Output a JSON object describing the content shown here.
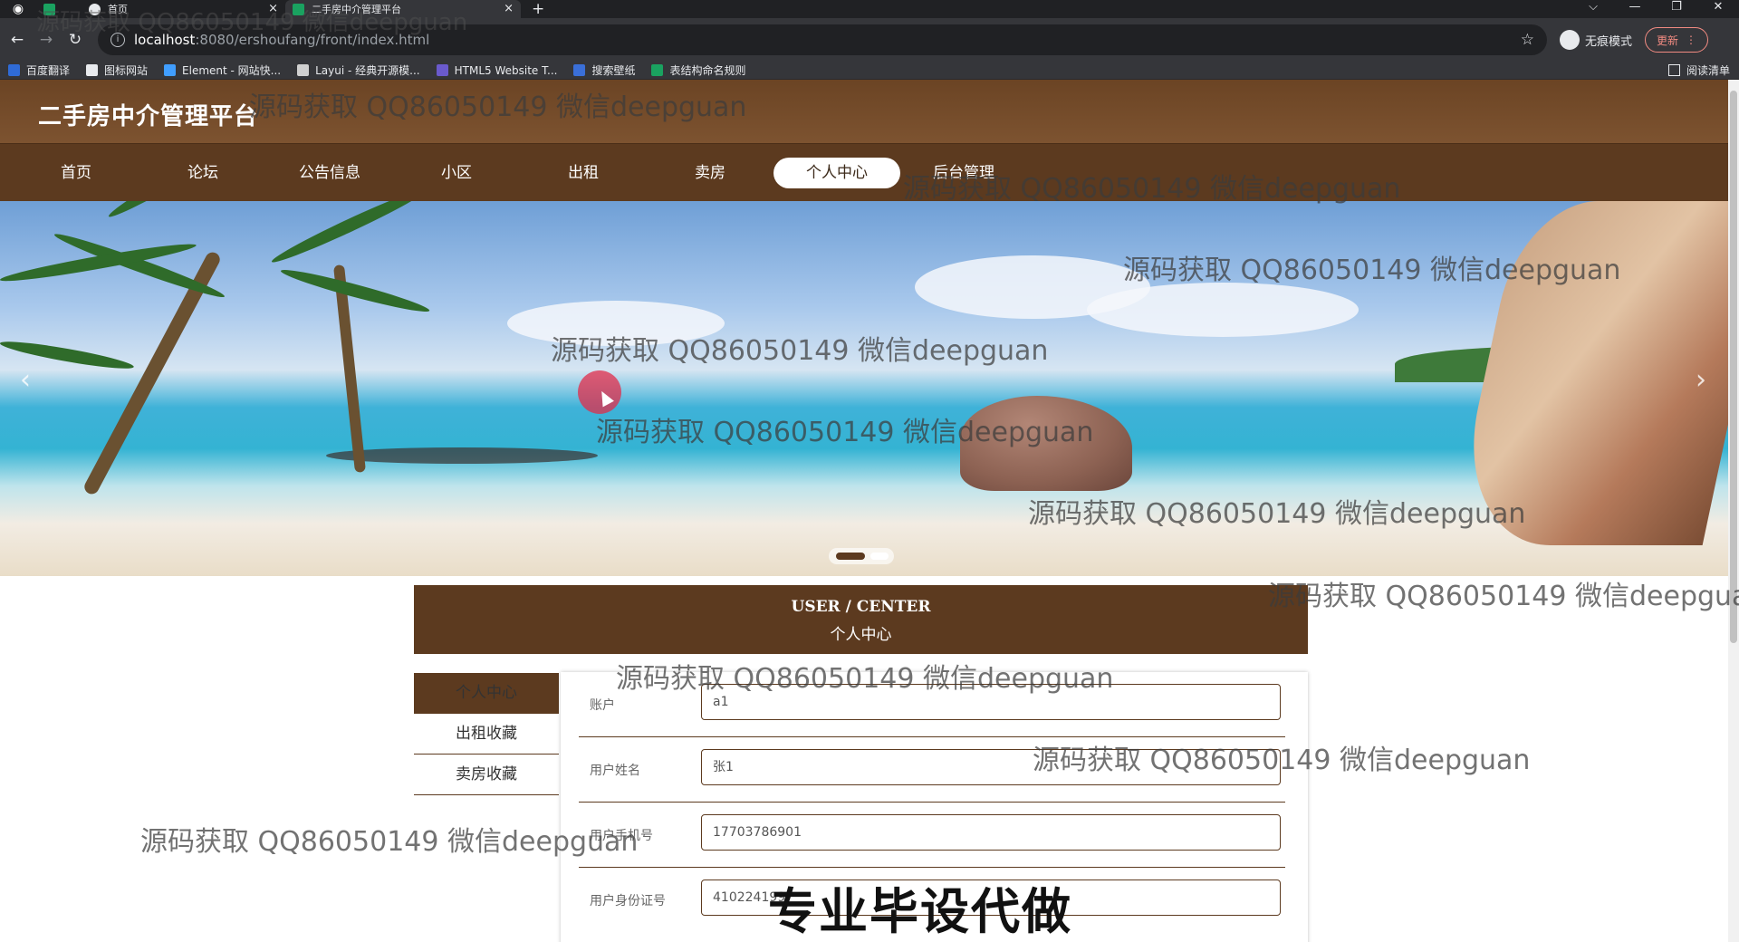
{
  "browser": {
    "tabs": [
      {
        "label": ""
      },
      {
        "label": "首页"
      },
      {
        "label": "二手房中介管理平台"
      }
    ],
    "new_tab": "+",
    "window_controls": [
      "⌵",
      "—",
      "❐",
      "✕"
    ],
    "url_host": "localhost",
    "url_path": ":8080/ershoufang/front/index.html",
    "profile_label": "无痕模式",
    "update_label": "更新",
    "bookmarks": [
      {
        "label": "百度翻译",
        "color": "#2f6bd6"
      },
      {
        "label": "图标网站",
        "color": "#e8eaed"
      },
      {
        "label": "Element - 网站快...",
        "color": "#409eff"
      },
      {
        "label": "Layui - 经典开源模...",
        "color": "#d0d0d0"
      },
      {
        "label": "HTML5 Website T...",
        "color": "#6a5acd"
      },
      {
        "label": "搜索壁纸",
        "color": "#3a6fd8"
      },
      {
        "label": "表结构命名规则",
        "color": "#1aa260"
      }
    ],
    "reading_list": "阅读清单"
  },
  "site": {
    "title": "二手房中介管理平台",
    "nav": [
      "首页",
      "论坛",
      "公告信息",
      "小区",
      "出租",
      "卖房",
      "个人中心",
      "后台管理"
    ],
    "active_nav": "个人中心"
  },
  "banner": {
    "prev": "‹",
    "next": "›"
  },
  "user_center": {
    "title_en": "USER / CENTER",
    "title_cn": "个人中心",
    "menu": [
      "个人中心",
      "出租收藏",
      "卖房收藏"
    ],
    "fields": [
      {
        "label": "账户",
        "value": "a1"
      },
      {
        "label": "用户姓名",
        "value": "张1"
      },
      {
        "label": "用户手机号",
        "value": "17703786901"
      },
      {
        "label": "用户身份证号",
        "value": "410224199"
      }
    ]
  },
  "overlays": {
    "watermark": "源码获取 QQ86050149 微信deepguan",
    "stamp": "专业毕设代做"
  },
  "colors": {
    "brand_brown": "#5c3a1f",
    "header_brown": "#7d5330",
    "browser_dark": "#202124"
  }
}
